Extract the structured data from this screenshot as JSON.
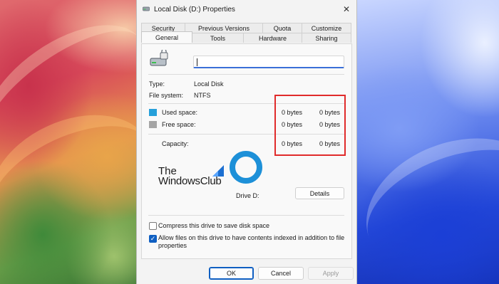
{
  "window": {
    "title": "Local Disk (D:) Properties",
    "close_glyph": "✕"
  },
  "tabs_back": [
    "Security",
    "Previous Versions",
    "Quota",
    "Customize"
  ],
  "tabs_front": [
    "General",
    "Tools",
    "Hardware",
    "Sharing"
  ],
  "active_tab": "General",
  "general": {
    "name_value": "",
    "type_label": "Type:",
    "type_value": "Local Disk",
    "fs_label": "File system:",
    "fs_value": "NTFS",
    "used_label": "Used space:",
    "used_bytes": "0 bytes",
    "used_size": "0 bytes",
    "free_label": "Free space:",
    "free_bytes": "0 bytes",
    "free_size": "0 bytes",
    "capacity_label": "Capacity:",
    "capacity_bytes": "0 bytes",
    "capacity_size": "0 bytes",
    "drive_label": "Drive D:",
    "details_button": "Details",
    "compress_label": "Compress this drive to save disk space",
    "compress_checked": false,
    "index_label_line1": "Allow files on this drive to have contents indexed in addition to file",
    "index_label_line2": "properties",
    "index_checked": true,
    "used_color": "#26a0da",
    "free_color": "#a5a5a5",
    "pie_color": "#1d90d8"
  },
  "watermark": {
    "line1": "The",
    "line2": "WindowsClub"
  },
  "buttons": {
    "ok": "OK",
    "cancel": "Cancel",
    "apply": "Apply"
  },
  "annotation_color": "#e02b2b"
}
